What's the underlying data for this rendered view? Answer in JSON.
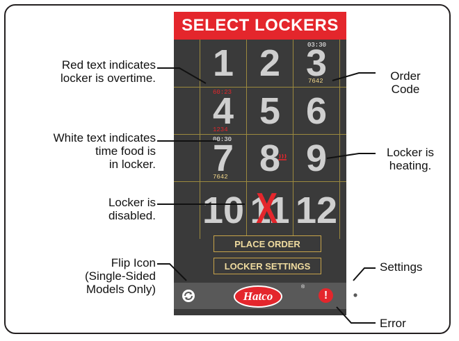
{
  "screen": {
    "title": "SELECT LOCKERS",
    "lockers": [
      {
        "number": "1"
      },
      {
        "number": "2"
      },
      {
        "number": "3",
        "time": "03:30",
        "code": "7642"
      },
      {
        "number": "4",
        "time": "60:23",
        "code": "1234"
      },
      {
        "number": "5"
      },
      {
        "number": "6"
      },
      {
        "number": "7",
        "time": "00:30",
        "code": "7642"
      },
      {
        "number": "8"
      },
      {
        "number": "9"
      },
      {
        "number": "10"
      },
      {
        "number": "11",
        "disabled_mark": "X"
      },
      {
        "number": "12"
      }
    ],
    "buttons": {
      "place_order": "PLACE ORDER",
      "locker_settings": "LOCKER SETTINGS"
    },
    "footer": {
      "logo_text": "Hatco",
      "registered_mark": "®",
      "error_mark": "!"
    }
  },
  "callouts": {
    "red_text": [
      "Red text indicates",
      "locker is overtime."
    ],
    "order_code": [
      "Order",
      "Code"
    ],
    "white_text": [
      "White text indicates",
      "time food is",
      "in locker."
    ],
    "heating": [
      "Locker is",
      "heating."
    ],
    "disabled": [
      "Locker is",
      "disabled."
    ],
    "flip": [
      "Flip Icon",
      "(Single-Sided",
      "Models Only)"
    ],
    "settings": [
      "Settings"
    ],
    "error": [
      "Error"
    ]
  },
  "colors": {
    "accent_red": "#e4262c",
    "panel": "#3a3a3a",
    "gold": "#c8a44a"
  },
  "icons": [
    "flip-icon",
    "settings-gear-icon",
    "error-icon",
    "heating-icon",
    "hatco-logo"
  ]
}
